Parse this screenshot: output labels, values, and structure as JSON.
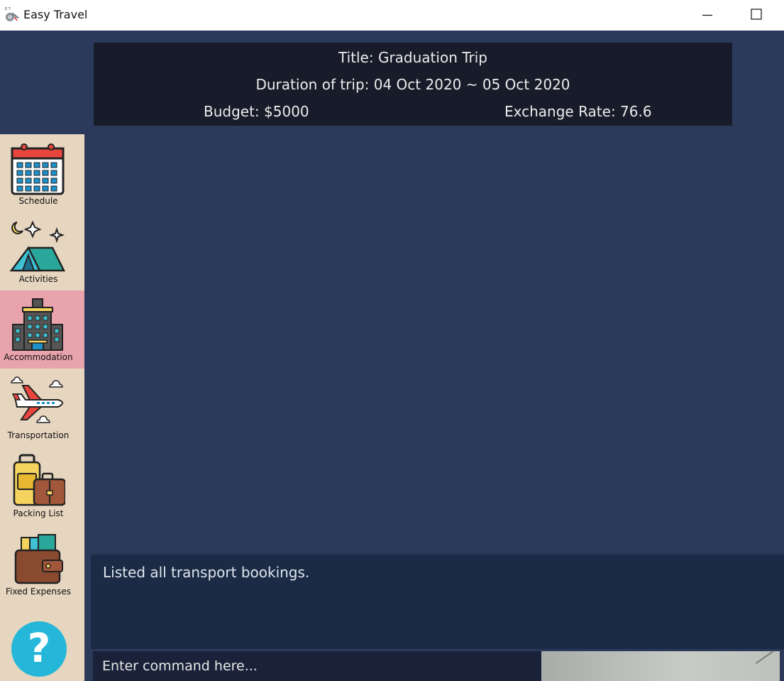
{
  "window": {
    "title": "Easy Travel",
    "icon": "easy-travel-logo-icon",
    "minimize_icon": "minimize-icon",
    "maximize_icon": "maximize-icon"
  },
  "trip": {
    "title": "Title: Graduation Trip",
    "duration": "Duration of trip: 04 Oct 2020 ~ 05 Oct 2020",
    "budget": "Budget: $5000",
    "exchange_rate": "Exchange Rate: 76.6"
  },
  "sidebar": {
    "items": [
      {
        "label": "Schedule",
        "icon": "calendar-icon",
        "active": false
      },
      {
        "label": "Activities",
        "icon": "tent-icon",
        "active": false
      },
      {
        "label": "Accommodation",
        "icon": "hotel-icon",
        "active": true
      },
      {
        "label": "Transportation",
        "icon": "airplane-icon",
        "active": false
      },
      {
        "label": "Packing List",
        "icon": "luggage-icon",
        "active": false
      },
      {
        "label": "Fixed Expenses",
        "icon": "wallet-icon",
        "active": false
      }
    ],
    "help_icon": "help-icon",
    "help_label": "?"
  },
  "result": {
    "text": "Listed all transport bookings."
  },
  "command": {
    "placeholder": "Enter command here..."
  },
  "colors": {
    "background": "#2b3a5a",
    "trip_panel": "#181b29",
    "sidebar": "#e6d5bf",
    "active_item": "#e8a3ac",
    "help_button": "#25b7d9",
    "result_box": "#1b2a45",
    "command_box": "#192238"
  }
}
